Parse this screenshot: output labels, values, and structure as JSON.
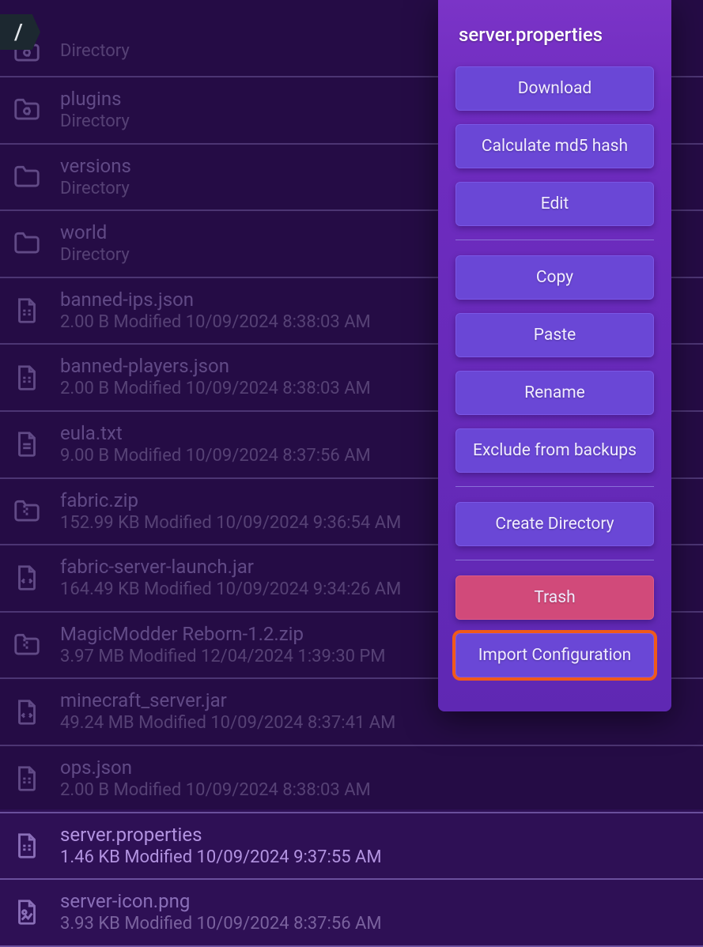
{
  "breadcrumb": "/",
  "context_menu": {
    "title": "server.properties",
    "groups": [
      [
        {
          "id": "download",
          "label": "Download",
          "style": "normal"
        },
        {
          "id": "md5",
          "label": "Calculate md5 hash",
          "style": "normal"
        },
        {
          "id": "edit",
          "label": "Edit",
          "style": "normal"
        }
      ],
      [
        {
          "id": "copy",
          "label": "Copy",
          "style": "normal"
        },
        {
          "id": "paste",
          "label": "Paste",
          "style": "normal"
        },
        {
          "id": "rename",
          "label": "Rename",
          "style": "normal"
        },
        {
          "id": "exclude",
          "label": "Exclude from backups",
          "style": "normal"
        }
      ],
      [
        {
          "id": "mkdir",
          "label": "Create Directory",
          "style": "normal"
        }
      ],
      [
        {
          "id": "trash",
          "label": "Trash",
          "style": "danger"
        },
        {
          "id": "importcfg",
          "label": "Import Configuration",
          "style": "highlight"
        }
      ]
    ]
  },
  "files": [
    {
      "name": "",
      "sub": "Directory",
      "icon": "folder-gear",
      "first": true
    },
    {
      "name": "plugins",
      "sub": "Directory",
      "icon": "folder-gear"
    },
    {
      "name": "versions",
      "sub": "Directory",
      "icon": "folder"
    },
    {
      "name": "world",
      "sub": "Directory",
      "icon": "folder"
    },
    {
      "name": "banned-ips.json",
      "sub": "2.00 B Modified 10/09/2024 8:38:03 AM",
      "icon": "file-settings"
    },
    {
      "name": "banned-players.json",
      "sub": "2.00 B Modified 10/09/2024 8:38:03 AM",
      "icon": "file-settings"
    },
    {
      "name": "eula.txt",
      "sub": "9.00 B Modified 10/09/2024 8:37:56 AM",
      "icon": "file-text"
    },
    {
      "name": "fabric.zip",
      "sub": "152.99 KB Modified 10/09/2024 9:36:54 AM",
      "icon": "folder-zip"
    },
    {
      "name": "fabric-server-launch.jar",
      "sub": "164.49 KB Modified 10/09/2024 9:34:26 AM",
      "icon": "file-code"
    },
    {
      "name": "MagicModder Reborn-1.2.zip",
      "sub": "3.97 MB Modified 12/04/2024 1:39:30 PM",
      "icon": "folder-zip"
    },
    {
      "name": "minecraft_server.jar",
      "sub": "49.24 MB Modified 10/09/2024 8:37:41 AM",
      "icon": "file-code"
    },
    {
      "name": "ops.json",
      "sub": "2.00 B Modified 10/09/2024 8:38:03 AM",
      "icon": "file-settings"
    },
    {
      "name": "server.properties",
      "sub": "1.46 KB Modified 10/09/2024 9:37:55 AM",
      "icon": "file-settings",
      "selected": true
    },
    {
      "name": "server-icon.png",
      "sub": "3.93 KB Modified 10/09/2024 8:37:56 AM",
      "icon": "file-image"
    }
  ]
}
